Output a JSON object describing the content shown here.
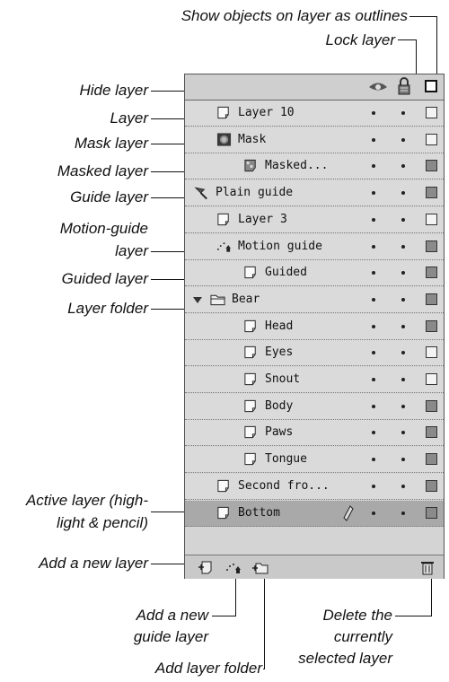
{
  "callouts": {
    "show_outlines": "Show objects on layer as outlines",
    "lock_layer": "Lock layer",
    "hide_layer": "Hide layer",
    "layer": "Layer",
    "mask_layer": "Mask layer",
    "masked_layer": "Masked layer",
    "guide_layer": "Guide layer",
    "motion_guide_line1": "Motion-guide",
    "motion_guide_line2": "layer",
    "guided_layer": "Guided layer",
    "layer_folder": "Layer folder",
    "active_layer_line1": "Active layer (high-",
    "active_layer_line2": "light & pencil)",
    "add_new_layer": "Add a new layer",
    "add_guide_line1": "Add a new",
    "add_guide_line2": "guide layer",
    "add_folder": "Add layer folder",
    "delete_line1": "Delete the",
    "delete_line2": "currently",
    "delete_line3": "selected layer"
  },
  "layers": [
    {
      "name": "Layer 10",
      "icon": "normal-layer-icon",
      "outline": true
    },
    {
      "name": "Mask",
      "icon": "mask-layer-icon",
      "outline": true
    },
    {
      "name": "Masked...",
      "icon": "masked-layer-icon",
      "outline": false
    },
    {
      "name": "Plain guide",
      "icon": "guide-layer-icon",
      "outline": false
    },
    {
      "name": "Layer 3",
      "icon": "normal-layer-icon",
      "outline": true
    },
    {
      "name": "Motion guide",
      "icon": "motion-guide-icon",
      "outline": false
    },
    {
      "name": "Guided",
      "icon": "normal-layer-icon",
      "outline": false
    },
    {
      "name": "Bear",
      "icon": "folder-icon",
      "outline": false
    },
    {
      "name": "Head",
      "icon": "normal-layer-icon",
      "outline": false
    },
    {
      "name": "Eyes",
      "icon": "normal-layer-icon",
      "outline": true
    },
    {
      "name": "Snout",
      "icon": "normal-layer-icon",
      "outline": true
    },
    {
      "name": "Body",
      "icon": "normal-layer-icon",
      "outline": false
    },
    {
      "name": "Paws",
      "icon": "normal-layer-icon",
      "outline": false
    },
    {
      "name": "Tongue",
      "icon": "normal-layer-icon",
      "outline": false
    },
    {
      "name": "Second fro...",
      "icon": "normal-layer-icon",
      "outline": false
    },
    {
      "name": "Bottom",
      "icon": "normal-layer-icon",
      "outline": false,
      "active": true
    }
  ],
  "icons": {
    "header": [
      "eye-icon",
      "lock-icon",
      "outline-square-icon"
    ],
    "footer": [
      "add-layer-icon",
      "add-guide-layer-icon",
      "add-folder-icon",
      "trash-icon"
    ]
  }
}
